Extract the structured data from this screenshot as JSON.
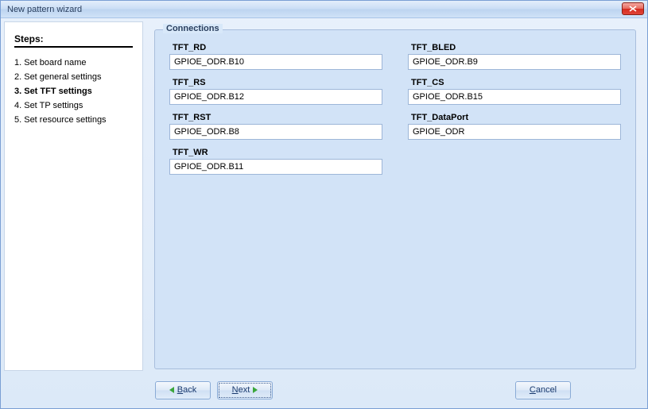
{
  "window": {
    "title": "New pattern wizard"
  },
  "sidebar": {
    "heading": "Steps:",
    "items": [
      {
        "label": "1. Set board name",
        "current": false
      },
      {
        "label": "2. Set general settings",
        "current": false
      },
      {
        "label": "3. Set TFT settings",
        "current": true
      },
      {
        "label": "4. Set TP settings",
        "current": false
      },
      {
        "label": "5. Set resource settings",
        "current": false
      }
    ]
  },
  "fieldset": {
    "legend": "Connections"
  },
  "left_fields": [
    {
      "label": "TFT_RD",
      "value": "GPIOE_ODR.B10"
    },
    {
      "label": "TFT_RS",
      "value": "GPIOE_ODR.B12"
    },
    {
      "label": "TFT_RST",
      "value": "GPIOE_ODR.B8"
    },
    {
      "label": "TFT_WR",
      "value": "GPIOE_ODR.B11"
    }
  ],
  "right_fields": [
    {
      "label": "TFT_BLED",
      "value": "GPIOE_ODR.B9"
    },
    {
      "label": "TFT_CS",
      "value": "GPIOE_ODR.B15"
    },
    {
      "label": "TFT_DataPort",
      "value": "GPIOE_ODR"
    }
  ],
  "buttons": {
    "back": "ack",
    "back_m": "B",
    "next": "ext",
    "next_m": "N",
    "cancel": "ancel",
    "cancel_m": "C"
  }
}
